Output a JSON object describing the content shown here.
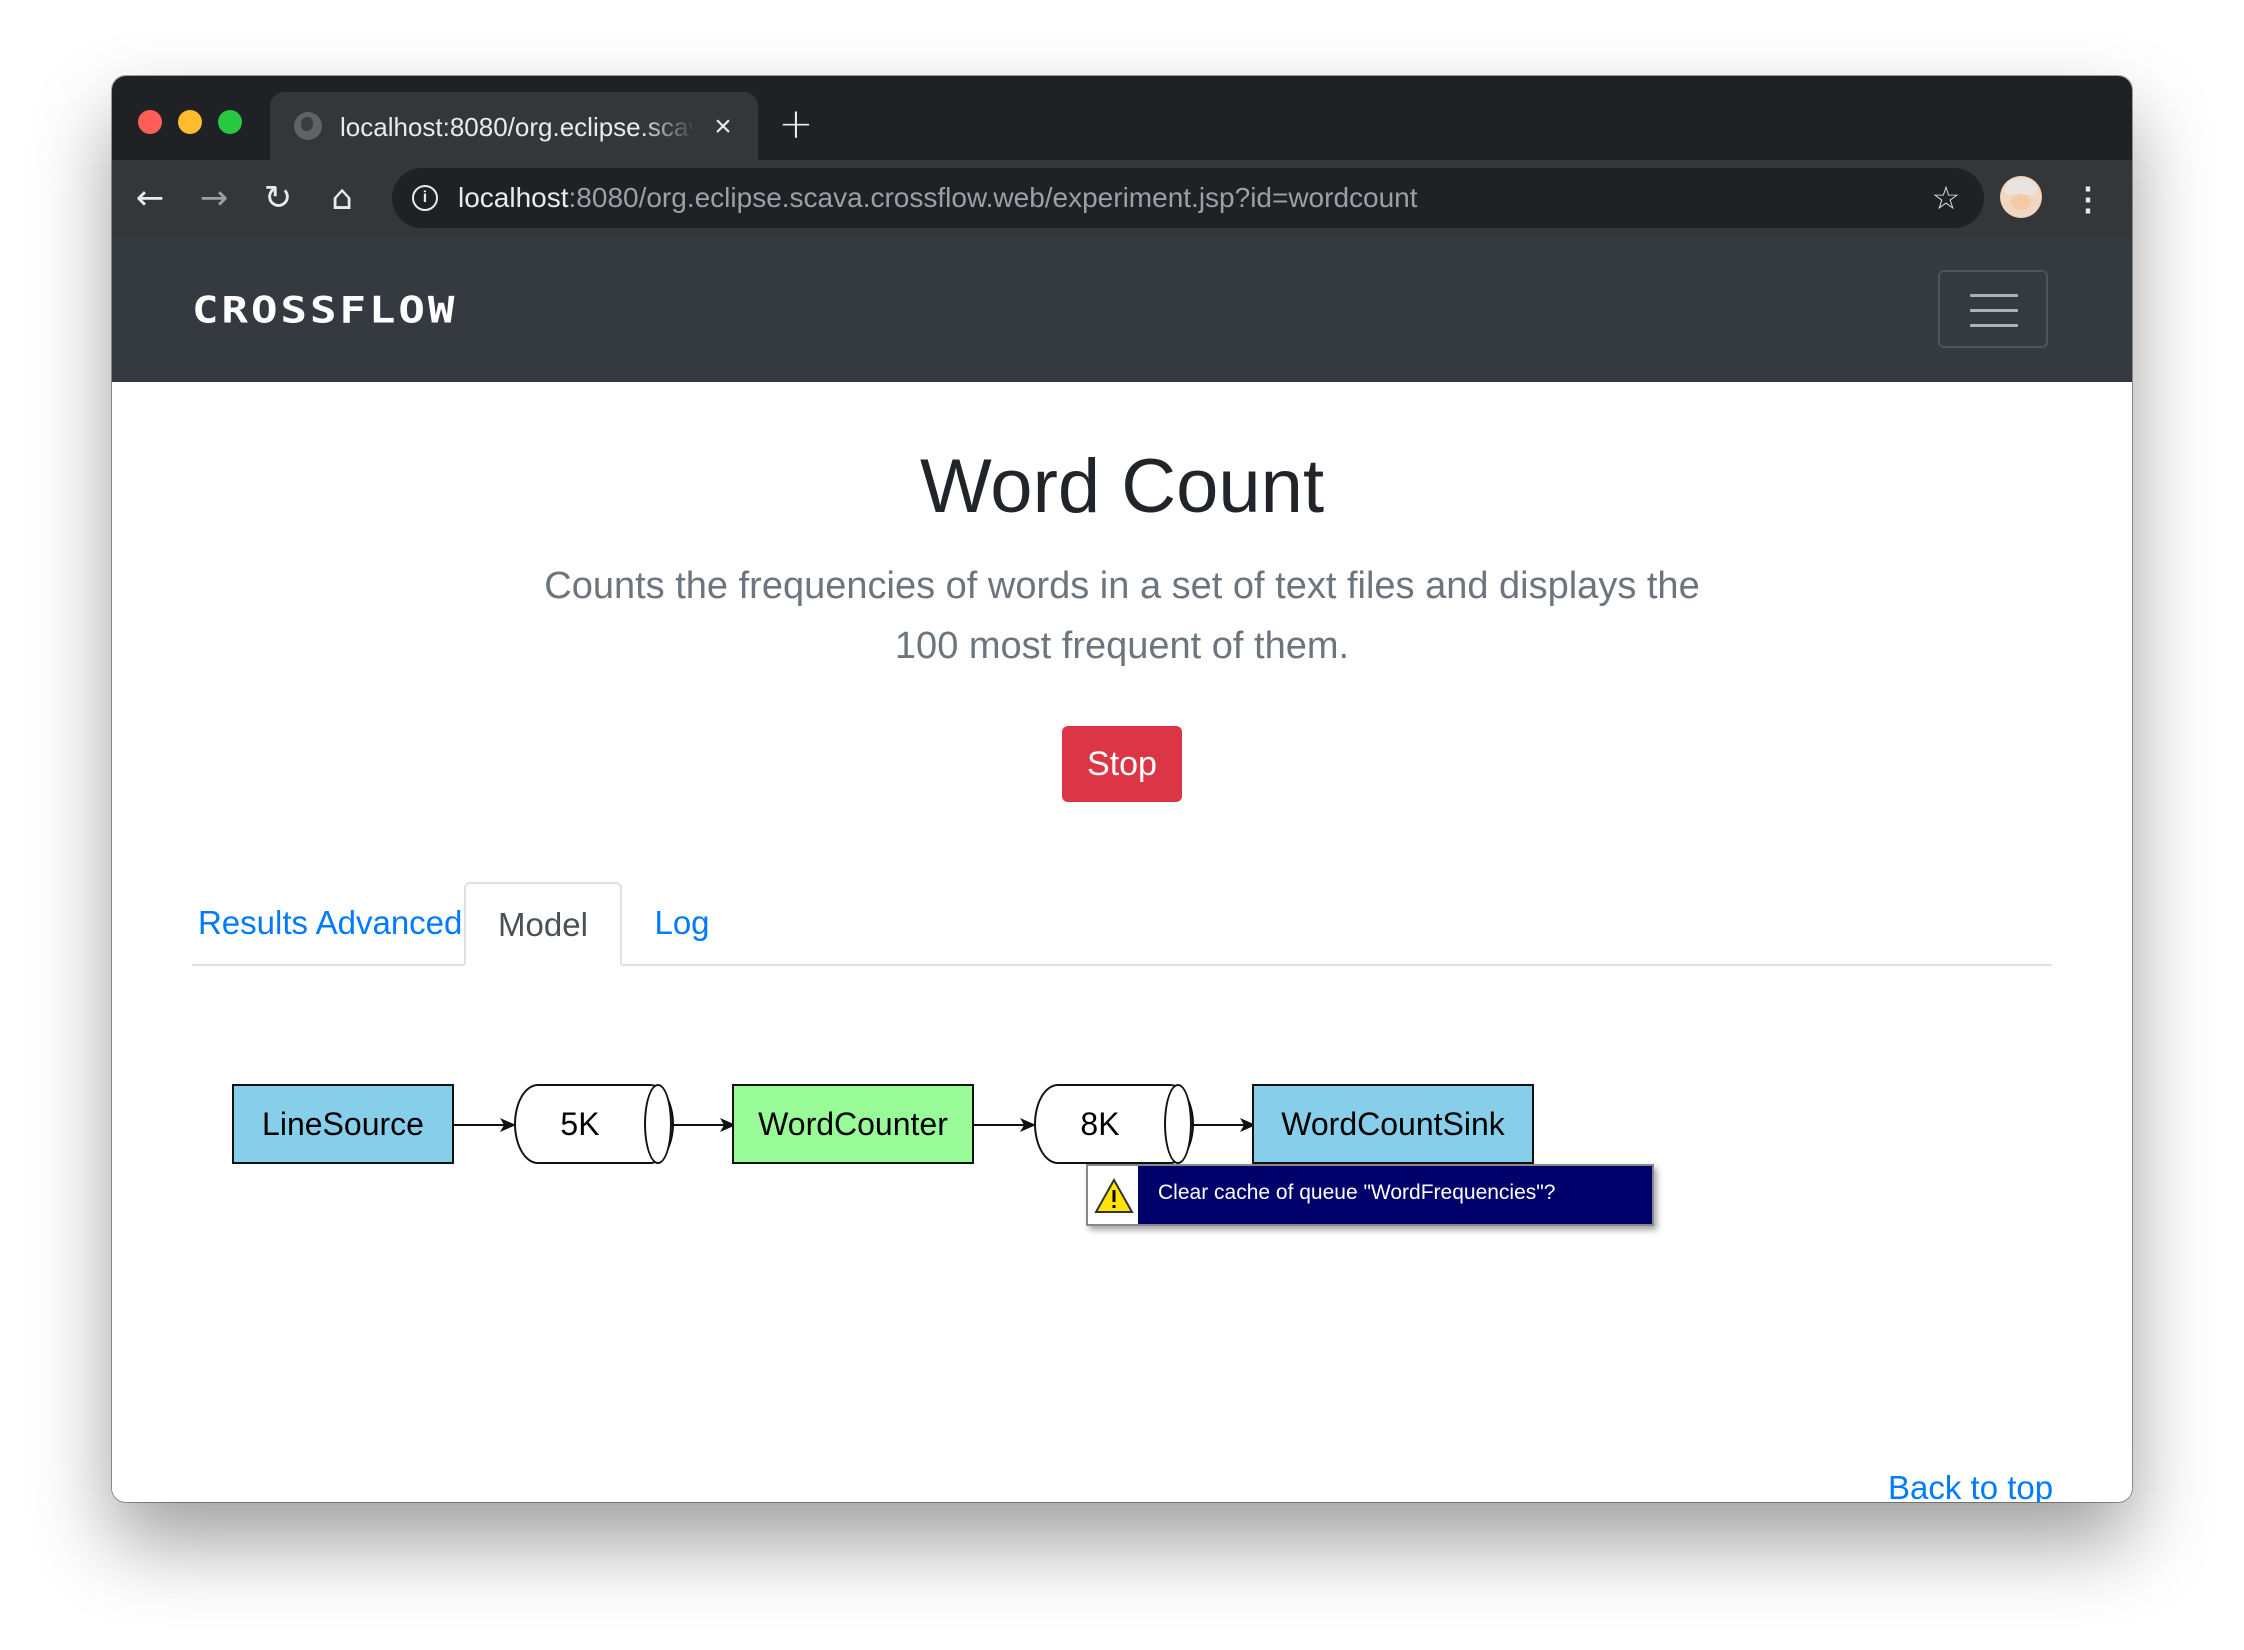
{
  "browser": {
    "tab_title": "localhost:8080/org.eclipse.scava.crossflow.web/experiment.jsp?id=wordcount",
    "tab_close": "×",
    "new_tab": "+",
    "url_host": "localhost",
    "url_rest": ":8080/org.eclipse.scava.crossflow.web/experiment.jsp?id=wordcount",
    "back": "←",
    "forward": "→",
    "reload": "↻",
    "home": "⌂",
    "bookmark": "☆",
    "menu": "⋮"
  },
  "navbar": {
    "brand": "CROSSFLOW"
  },
  "header": {
    "title": "Word Count",
    "description": "Counts the frequencies of words in a set of text files and displays the 100 most frequent of them.",
    "stop_label": "Stop",
    "stop_color": "#dc3545"
  },
  "tabs": [
    {
      "label": "Results",
      "active": false
    },
    {
      "label": "Advanced",
      "active": false
    },
    {
      "label": "Model",
      "active": true
    },
    {
      "label": "Log",
      "active": false
    }
  ],
  "model": {
    "source": {
      "label": "LineSource",
      "color": "#87ceeb"
    },
    "queue1": {
      "label": "5K"
    },
    "task": {
      "label": "WordCounter",
      "color": "#98fb98"
    },
    "queue2": {
      "label": "8K"
    },
    "sink": {
      "label": "WordCountSink",
      "color": "#87ceeb"
    }
  },
  "tooltip": {
    "text": "Clear cache of queue \"WordFrequencies\"?",
    "icon": "warning-icon"
  },
  "footer": {
    "back_to_top": "Back to top"
  },
  "colors": {
    "link": "#007bff",
    "navbar_bg": "#343a40"
  }
}
